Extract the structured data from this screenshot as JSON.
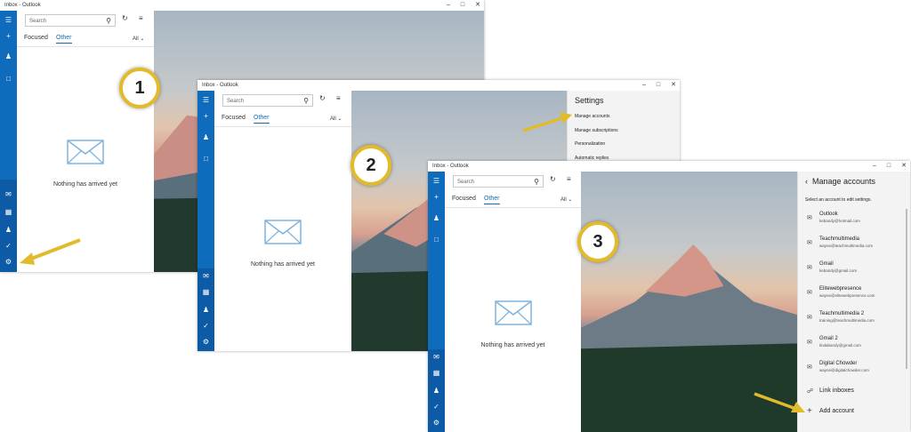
{
  "window1": {
    "title": "Inbox - Outlook",
    "search_placeholder": "Search",
    "tab_focused": "Focused",
    "tab_other": "Other",
    "filter": "All",
    "empty_text": "Nothing has arrived yet"
  },
  "window2": {
    "title": "Inbox - Outlook",
    "search_placeholder": "Search",
    "tab_focused": "Focused",
    "tab_other": "Other",
    "filter": "All",
    "empty_text": "Nothing has arrived yet",
    "settings": {
      "title": "Settings",
      "items": [
        "Manage accounts",
        "Manage subscriptions",
        "Personalization",
        "Automatic replies"
      ]
    }
  },
  "window3": {
    "title": "Inbox - Outlook",
    "search_placeholder": "Search",
    "tab_focused": "Focused",
    "tab_other": "Other",
    "filter": "All",
    "empty_text": "Nothing has arrived yet",
    "manage": {
      "title": "Manage accounts",
      "subtitle": "Select an account to edit settings.",
      "accounts": [
        {
          "name": "Outlook",
          "email": "kebandy@hotmail.com"
        },
        {
          "name": "Teachmultimedia",
          "email": "wayne@teachmultimedia.com"
        },
        {
          "name": "Gmail",
          "email": "kebandy@gmail.com"
        },
        {
          "name": "Elitewebpresence",
          "email": "wayne@elitewebpresence.com"
        },
        {
          "name": "Teachmultimedia 2",
          "email": "training@teachmultimedia.com"
        },
        {
          "name": "Gmail 2",
          "email": "lindabandy@gmail.com"
        },
        {
          "name": "Digital Chowder",
          "email": "wayne@digitalchowder.com"
        }
      ],
      "link_inboxes": "Link inboxes",
      "add_account": "Add account"
    }
  },
  "steps": [
    "1",
    "2",
    "3"
  ],
  "colors": {
    "accent": "#0f6cbd",
    "badge_ring": "#e2bb2c"
  }
}
